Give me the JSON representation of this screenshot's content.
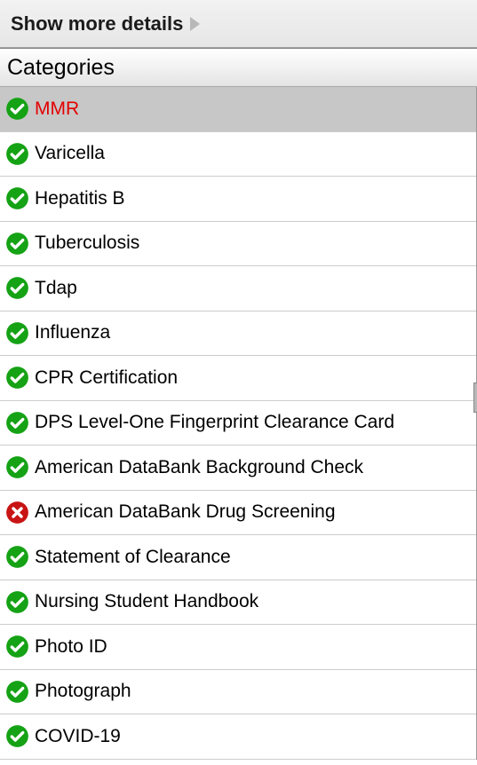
{
  "top_bar": {
    "label": "Show more details"
  },
  "section": {
    "header": "Categories"
  },
  "items": [
    {
      "label": "MMR",
      "status": "check",
      "selected": true
    },
    {
      "label": "Varicella",
      "status": "check",
      "selected": false
    },
    {
      "label": "Hepatitis B",
      "status": "check",
      "selected": false
    },
    {
      "label": "Tuberculosis",
      "status": "check",
      "selected": false
    },
    {
      "label": "Tdap",
      "status": "check",
      "selected": false
    },
    {
      "label": "Influenza",
      "status": "check",
      "selected": false
    },
    {
      "label": "CPR Certification",
      "status": "check",
      "selected": false
    },
    {
      "label": "DPS Level-One Fingerprint Clearance Card",
      "status": "check",
      "selected": false
    },
    {
      "label": "American DataBank Background Check",
      "status": "check",
      "selected": false
    },
    {
      "label": "American DataBank Drug Screening",
      "status": "fail",
      "selected": false
    },
    {
      "label": "Statement of Clearance",
      "status": "check",
      "selected": false
    },
    {
      "label": "Nursing Student Handbook",
      "status": "check",
      "selected": false
    },
    {
      "label": "Photo ID",
      "status": "check",
      "selected": false
    },
    {
      "label": "Photograph",
      "status": "check",
      "selected": false
    },
    {
      "label": "COVID-19",
      "status": "check",
      "selected": false
    }
  ],
  "colors": {
    "check": "#15a215",
    "fail": "#c81414"
  }
}
